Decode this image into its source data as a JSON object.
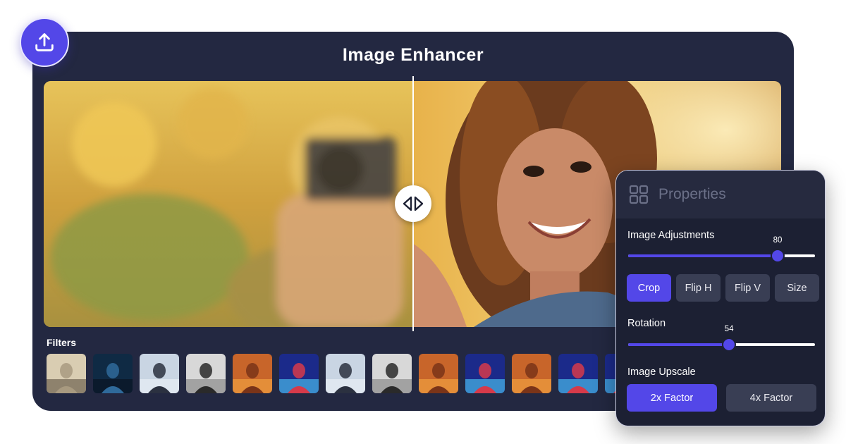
{
  "app": {
    "title": "Image Enhancer"
  },
  "toolbar": {
    "upload_icon": "upload-icon"
  },
  "compare": {
    "icon": "compare-arrows-icon"
  },
  "filters": {
    "label": "Filters",
    "thumbnails": [
      "bridge-sepia",
      "night-sky",
      "winter-portrait",
      "bw-portrait",
      "warm-portrait",
      "neon-portrait",
      "winter-portrait",
      "bw-portrait",
      "warm-portrait",
      "neon-portrait",
      "warm-portrait",
      "neon-portrait",
      "neon-portrait"
    ]
  },
  "properties": {
    "title": "Properties",
    "icon": "grid-icon",
    "adjustments": {
      "label": "Image Adjustments",
      "value": 80
    },
    "tools": [
      {
        "label": "Crop",
        "active": true
      },
      {
        "label": "Flip H",
        "active": false
      },
      {
        "label": "Flip V",
        "active": false
      },
      {
        "label": "Size",
        "active": false
      }
    ],
    "rotation": {
      "label": "Rotation",
      "value": 54
    },
    "upscale": {
      "label": "Image Upscale",
      "options": [
        {
          "label": "2x Factor",
          "active": true
        },
        {
          "label": "4x Factor",
          "active": false
        }
      ]
    }
  },
  "colors": {
    "accent": "#5347e8",
    "panel": "#232841",
    "props_bg": "#1c2033"
  }
}
